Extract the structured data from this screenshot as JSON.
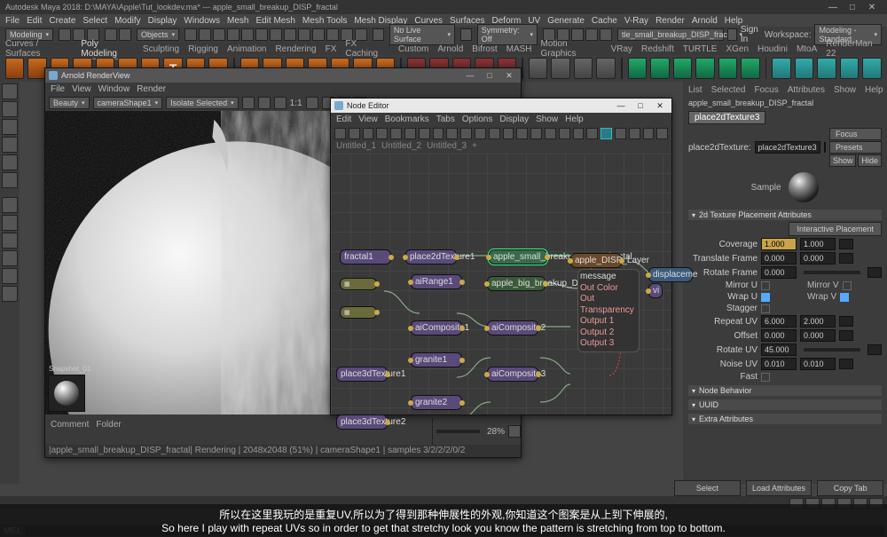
{
  "app": {
    "title": "Autodesk Maya 2018: D:\\MAYA\\Apple\\Tut_lookdev.ma*  ---  apple_small_breakup_DISP_fractal"
  },
  "mainmenu": [
    "File",
    "Edit",
    "Create",
    "Select",
    "Modify",
    "Display",
    "Windows",
    "Mesh",
    "Edit Mesh",
    "Mesh Tools",
    "Mesh Display",
    "Curves",
    "Surfaces",
    "Deform",
    "UV",
    "Generate",
    "Cache",
    "V-Ray",
    "Render",
    "Arnold",
    "Help"
  ],
  "workspace": {
    "label": "Workspace:",
    "value": "Modeling - Standard"
  },
  "mode_dropdown": "Modeling",
  "object_dropdown": "Objects",
  "no_live_surface": "No Live Surface",
  "symmetry": "Symmetry: Off",
  "crumb_field": "tle_small_breakup_DISP_fractal",
  "signin": "Sign In",
  "shelf_tabs": [
    "Curves / Surfaces",
    "Poly Modeling",
    "Sculpting",
    "Rigging",
    "Animation",
    "Rendering",
    "FX",
    "FX Caching",
    "Custom",
    "Arnold",
    "Bifrost",
    "MASH",
    "Motion Graphics",
    "VRay",
    "Redshift",
    "TURTLE",
    "XGen",
    "Houdini",
    "MtoA",
    "RenderMan 22"
  ],
  "shelf_active": "Poly Modeling",
  "arnold_win": {
    "title": "Arnold RenderView",
    "menu": [
      "File",
      "View",
      "Window",
      "Render"
    ],
    "toolbar": {
      "d1": "Beauty",
      "d2": "cameraShape1",
      "d3": "Isolate Selected",
      "ratio": "1:1"
    },
    "snapshot": "Snapshot_01",
    "comment_tab": "Comment",
    "folder_tab": "Folder",
    "zoom": "28%",
    "status": "|apple_small_breakup_DISP_fractal| Rendering  | 2048x2048 (51%) | cameraShape1 | samples 3/2/2/2/0/2"
  },
  "nodeed_win": {
    "title": "Node Editor",
    "menu": [
      "Edit",
      "View",
      "Bookmarks",
      "Tabs",
      "Options",
      "Display",
      "Show",
      "Help"
    ],
    "tabs": [
      "Untitled_1",
      "Untitled_2",
      "Untitled_3"
    ],
    "nodes": {
      "p2d1": "place2dTexture1",
      "fractal1": "fractal1",
      "aiRange1": "aiRange1",
      "aiComp1": "aiComposite1",
      "granite1": "granite1",
      "p3d1": "place3dTexture1",
      "granite2": "granite2",
      "p3d2": "place3dTexture2",
      "big_noise": "apple_big_breakup_DISP_Noise",
      "small_fractal": "apple_small_breakup_DISP_fractal",
      "aiComp2": "aiComposite2",
      "aiComp3": "aiComposite3",
      "layer": "apple_DISP_Layer",
      "disp": "displaceme",
      "vi": "vi",
      "attrs": {
        "msg": "message",
        "outc": "Out Color",
        "outt": "Out Transparency",
        "o1": "Output 1",
        "o2": "Output 2",
        "o3": "Output 3"
      }
    }
  },
  "attr": {
    "tabs": [
      "List",
      "Selected",
      "Focus",
      "Attributes",
      "Show",
      "Help"
    ],
    "path": "apple_small_breakup_DISP_fractal",
    "curtab": "place2dTexture3",
    "typelabel": "place2dTexture:",
    "typeval": "place2dTexture3",
    "focus": "Focus",
    "presets": "Presets",
    "show": "Show",
    "hide": "Hide",
    "sample": "Sample",
    "sec1": "2d Texture Placement Attributes",
    "ipbtn": "Interactive Placement",
    "rows": {
      "coverage": "Coverage",
      "translate": "Translate Frame",
      "rotateframe": "Rotate Frame",
      "mirroru": "Mirror U",
      "mirrorv": "Mirror V",
      "wrapu": "Wrap U",
      "wrapv": "Wrap V",
      "stagger": "Stagger",
      "repeatuv": "Repeat UV",
      "offset": "Offset",
      "rotateuv": "Rotate UV",
      "noiseuv": "Noise UV",
      "fast": "Fast"
    },
    "vals": {
      "coverage_u": "1.000",
      "coverage_v": "1.000",
      "translate_u": "0.000",
      "translate_v": "0.000",
      "rotateframe": "0.000",
      "repeat_u": "6.000",
      "repeat_v": "2.000",
      "offset_u": "0.000",
      "offset_v": "0.000",
      "rotateuv": "45.000",
      "noise_u": "0.010",
      "noise_v": "0.010"
    },
    "sec2": "Node Behavior",
    "sec3": "UUID",
    "sec4": "Extra Attributes"
  },
  "bottom_buttons": {
    "select": "Select",
    "load": "Load Attributes",
    "copy": "Copy Tab"
  },
  "cmd": {
    "lang": "MEL"
  },
  "subtitle": {
    "cn": "所以在这里我玩的是重复UV,所以为了得到那种伸展性的外观,你知道这个图案是从上到下伸展的,",
    "en": "So here I play with repeat UVs so in order to get that stretchy look you know the pattern is stretching from top to bottom."
  }
}
